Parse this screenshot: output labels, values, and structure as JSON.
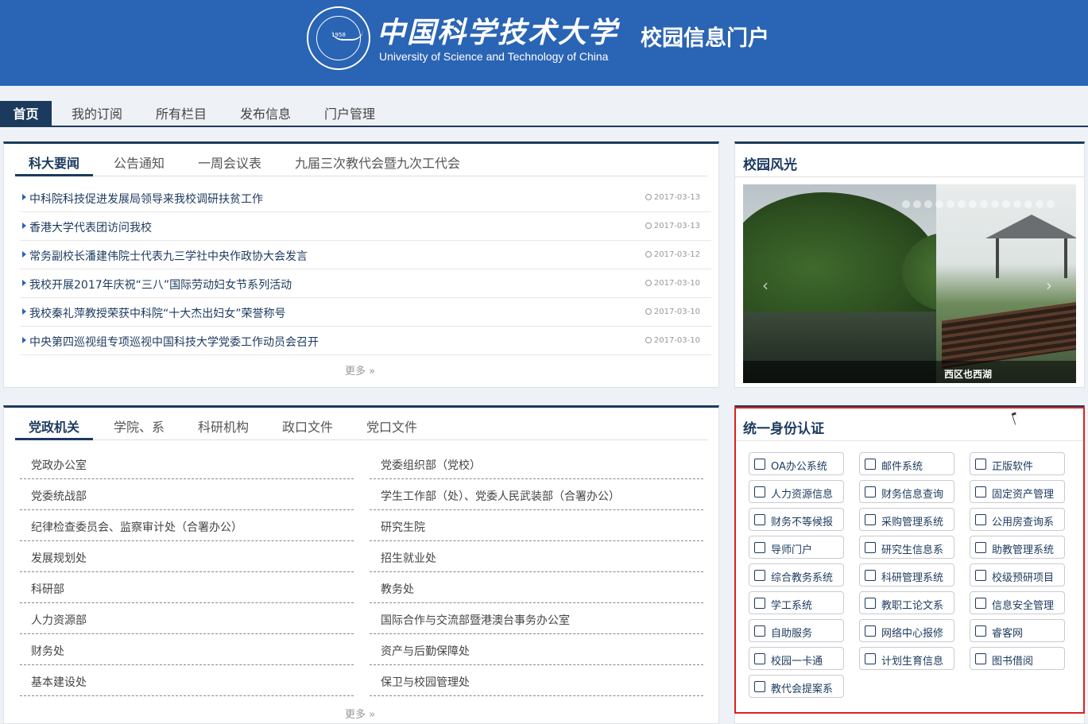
{
  "header": {
    "seal_year": "1958",
    "title_cn": "中国科学技术大学",
    "subtitle": "校园信息门户",
    "title_en": "University of Science and Technology of China"
  },
  "nav": {
    "items": [
      "首页",
      "我的订阅",
      "所有栏目",
      "发布信息",
      "门户管理"
    ]
  },
  "news": {
    "tabs": [
      "科大要闻",
      "公告通知",
      "一周会议表",
      "九届三次教代会暨九次工代会"
    ],
    "items": [
      {
        "title": "中科院科技促进发展局领导来我校调研扶贫工作",
        "date": "2017-03-13"
      },
      {
        "title": "香港大学代表团访问我校",
        "date": "2017-03-13"
      },
      {
        "title": "常务副校长潘建伟院士代表九三学社中央作政协大会发言",
        "date": "2017-03-12"
      },
      {
        "title": "我校开展2017年庆祝“三八”国际劳动妇女节系列活动",
        "date": "2017-03-10"
      },
      {
        "title": "我校秦礼萍教授荣获中科院“十大杰出妇女”荣誉称号",
        "date": "2017-03-10"
      },
      {
        "title": "中央第四巡视组专项巡视中国科技大学党委工作动员会召开",
        "date": "2017-03-10"
      }
    ],
    "more": "更多 »"
  },
  "campus": {
    "title": "校园风光",
    "caption": "西区也西湖",
    "prev": "‹",
    "next": "›"
  },
  "depts": {
    "tabs": [
      "党政机关",
      "学院、系",
      "科研机构",
      "政口文件",
      "党口文件"
    ],
    "left": [
      "党政办公室",
      "党委统战部",
      "纪律检查委员会、监察审计处（合署办公）",
      "发展规划处",
      "科研部",
      "人力资源部",
      "财务处",
      "基本建设处"
    ],
    "right": [
      "党委组织部（党校）",
      "学生工作部（处）、党委人民武装部（合署办公）",
      "研究生院",
      "招生就业处",
      "教务处",
      "国际合作与交流部暨港澳台事务办公室",
      "资产与后勤保障处",
      "保卫与校园管理处"
    ],
    "more": "更多 »"
  },
  "auth": {
    "title": "统一身份认证",
    "systems": [
      {
        "label": "OA办公系统",
        "icon": "edit-icon"
      },
      {
        "label": "邮件系统",
        "icon": "mail-icon"
      },
      {
        "label": "正版软件",
        "icon": "checkbox-icon"
      },
      {
        "label": "人力资源信息",
        "icon": "users-icon"
      },
      {
        "label": "财务信息查询",
        "icon": "bar-chart-icon"
      },
      {
        "label": "固定资产管理",
        "icon": "tag-icon"
      },
      {
        "label": "财务不等候报",
        "icon": "calculator-icon"
      },
      {
        "label": "采购管理系统",
        "icon": "inbox-icon"
      },
      {
        "label": "公用房查询系",
        "icon": "building-icon"
      },
      {
        "label": "导师门户",
        "icon": "globe-icon"
      },
      {
        "label": "研究生信息系",
        "icon": "image-icon"
      },
      {
        "label": "助教管理系统",
        "icon": "user-icon"
      },
      {
        "label": "综合教务系统",
        "icon": "sitemap-icon"
      },
      {
        "label": "科研管理系统",
        "icon": "atom-icon"
      },
      {
        "label": "校级预研项目",
        "icon": "bookmark-icon"
      },
      {
        "label": "学工系统",
        "icon": "graduation-cap-icon"
      },
      {
        "label": "教职工论文系",
        "icon": "book-icon"
      },
      {
        "label": "信息安全管理",
        "icon": "bell-icon"
      },
      {
        "label": "自助服务",
        "icon": "monitor-icon"
      },
      {
        "label": "网络中心报修",
        "icon": "wifi-icon"
      },
      {
        "label": "睿客网",
        "icon": "rec-icon"
      },
      {
        "label": "校园一卡通",
        "icon": "id-card-icon"
      },
      {
        "label": "计划生育信息",
        "icon": "heart-icon"
      },
      {
        "label": "图书借阅",
        "icon": "book-open-icon"
      },
      {
        "label": "教代会提案系",
        "icon": "globe-icon"
      }
    ]
  },
  "colors": {
    "header_bg": "#2a64b4",
    "accent": "#1c3a5e",
    "highlight_box": "#e02020"
  }
}
